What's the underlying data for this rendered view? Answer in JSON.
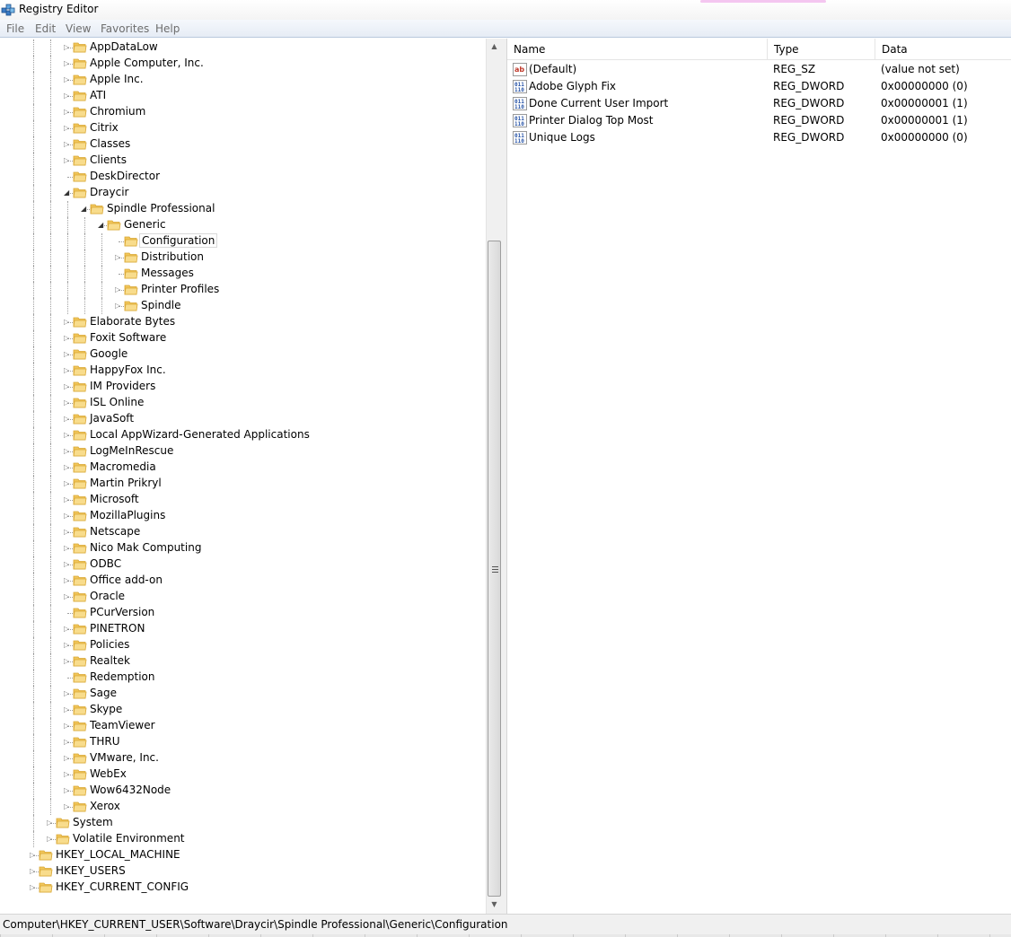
{
  "window": {
    "title": "Registry Editor"
  },
  "menu": [
    "File",
    "Edit",
    "View",
    "Favorites",
    "Help"
  ],
  "tree": [
    {
      "label": "AppDataLow",
      "level": 3,
      "toggle": "collapsed"
    },
    {
      "label": "Apple Computer, Inc.",
      "level": 3,
      "toggle": "collapsed"
    },
    {
      "label": "Apple Inc.",
      "level": 3,
      "toggle": "collapsed"
    },
    {
      "label": "ATI",
      "level": 3,
      "toggle": "collapsed"
    },
    {
      "label": "Chromium",
      "level": 3,
      "toggle": "collapsed"
    },
    {
      "label": "Citrix",
      "level": 3,
      "toggle": "collapsed"
    },
    {
      "label": "Classes",
      "level": 3,
      "toggle": "collapsed"
    },
    {
      "label": "Clients",
      "level": 3,
      "toggle": "collapsed"
    },
    {
      "label": "DeskDirector",
      "level": 3,
      "toggle": "none"
    },
    {
      "label": "Draycir",
      "level": 3,
      "toggle": "expanded"
    },
    {
      "label": "Spindle Professional",
      "level": 4,
      "toggle": "expanded"
    },
    {
      "label": "Generic",
      "level": 5,
      "toggle": "expanded"
    },
    {
      "label": "Configuration",
      "level": 6,
      "toggle": "none",
      "selected": true
    },
    {
      "label": "Distribution",
      "level": 6,
      "toggle": "collapsed"
    },
    {
      "label": "Messages",
      "level": 6,
      "toggle": "none"
    },
    {
      "label": "Printer Profiles",
      "level": 6,
      "toggle": "collapsed"
    },
    {
      "label": "Spindle",
      "level": 6,
      "toggle": "collapsed"
    },
    {
      "label": "Elaborate Bytes",
      "level": 3,
      "toggle": "collapsed"
    },
    {
      "label": "Foxit Software",
      "level": 3,
      "toggle": "collapsed"
    },
    {
      "label": "Google",
      "level": 3,
      "toggle": "collapsed"
    },
    {
      "label": "HappyFox Inc.",
      "level": 3,
      "toggle": "collapsed"
    },
    {
      "label": "IM Providers",
      "level": 3,
      "toggle": "collapsed"
    },
    {
      "label": "ISL Online",
      "level": 3,
      "toggle": "collapsed"
    },
    {
      "label": "JavaSoft",
      "level": 3,
      "toggle": "collapsed"
    },
    {
      "label": "Local AppWizard-Generated Applications",
      "level": 3,
      "toggle": "collapsed"
    },
    {
      "label": "LogMeInRescue",
      "level": 3,
      "toggle": "collapsed"
    },
    {
      "label": "Macromedia",
      "level": 3,
      "toggle": "collapsed"
    },
    {
      "label": "Martin Prikryl",
      "level": 3,
      "toggle": "collapsed"
    },
    {
      "label": "Microsoft",
      "level": 3,
      "toggle": "collapsed"
    },
    {
      "label": "MozillaPlugins",
      "level": 3,
      "toggle": "collapsed"
    },
    {
      "label": "Netscape",
      "level": 3,
      "toggle": "collapsed"
    },
    {
      "label": "Nico Mak Computing",
      "level": 3,
      "toggle": "collapsed"
    },
    {
      "label": "ODBC",
      "level": 3,
      "toggle": "collapsed"
    },
    {
      "label": "Office add-on",
      "level": 3,
      "toggle": "collapsed"
    },
    {
      "label": "Oracle",
      "level": 3,
      "toggle": "collapsed"
    },
    {
      "label": "PCurVersion",
      "level": 3,
      "toggle": "none"
    },
    {
      "label": "PINETRON",
      "level": 3,
      "toggle": "collapsed"
    },
    {
      "label": "Policies",
      "level": 3,
      "toggle": "collapsed"
    },
    {
      "label": "Realtek",
      "level": 3,
      "toggle": "collapsed"
    },
    {
      "label": "Redemption",
      "level": 3,
      "toggle": "none"
    },
    {
      "label": "Sage",
      "level": 3,
      "toggle": "collapsed"
    },
    {
      "label": "Skype",
      "level": 3,
      "toggle": "collapsed"
    },
    {
      "label": "TeamViewer",
      "level": 3,
      "toggle": "collapsed"
    },
    {
      "label": "THRU",
      "level": 3,
      "toggle": "collapsed"
    },
    {
      "label": "VMware, Inc.",
      "level": 3,
      "toggle": "collapsed"
    },
    {
      "label": "WebEx",
      "level": 3,
      "toggle": "collapsed"
    },
    {
      "label": "Wow6432Node",
      "level": 3,
      "toggle": "collapsed"
    },
    {
      "label": "Xerox",
      "level": 3,
      "toggle": "collapsed"
    },
    {
      "label": "System",
      "level": 2,
      "toggle": "collapsed"
    },
    {
      "label": "Volatile Environment",
      "level": 2,
      "toggle": "collapsed"
    },
    {
      "label": "HKEY_LOCAL_MACHINE",
      "level": 1,
      "toggle": "collapsed"
    },
    {
      "label": "HKEY_USERS",
      "level": 1,
      "toggle": "collapsed"
    },
    {
      "label": "HKEY_CURRENT_CONFIG",
      "level": 1,
      "toggle": "collapsed"
    }
  ],
  "list": {
    "headers": {
      "name": "Name",
      "type": "Type",
      "data": "Data"
    },
    "rows": [
      {
        "icon": "string-value-icon",
        "name": "(Default)",
        "type": "REG_SZ",
        "data": "(value not set)"
      },
      {
        "icon": "binary-value-icon",
        "name": "Adobe Glyph Fix",
        "type": "REG_DWORD",
        "data": "0x00000000 (0)"
      },
      {
        "icon": "binary-value-icon",
        "name": "Done Current User Import",
        "type": "REG_DWORD",
        "data": "0x00000001 (1)"
      },
      {
        "icon": "binary-value-icon",
        "name": "Printer Dialog Top Most",
        "type": "REG_DWORD",
        "data": "0x00000001 (1)"
      },
      {
        "icon": "binary-value-icon",
        "name": "Unique Logs",
        "type": "REG_DWORD",
        "data": "0x00000000 (0)"
      }
    ]
  },
  "status": {
    "path": "Computer\\HKEY_CURRENT_USER\\Software\\Draycir\\Spindle Professional\\Generic\\Configuration"
  },
  "colors": {
    "folder": "#f1c65b",
    "folder_dark": "#d9a632",
    "selection_border": "#d9d9d9",
    "menu_bg": "#e6ecf5"
  }
}
